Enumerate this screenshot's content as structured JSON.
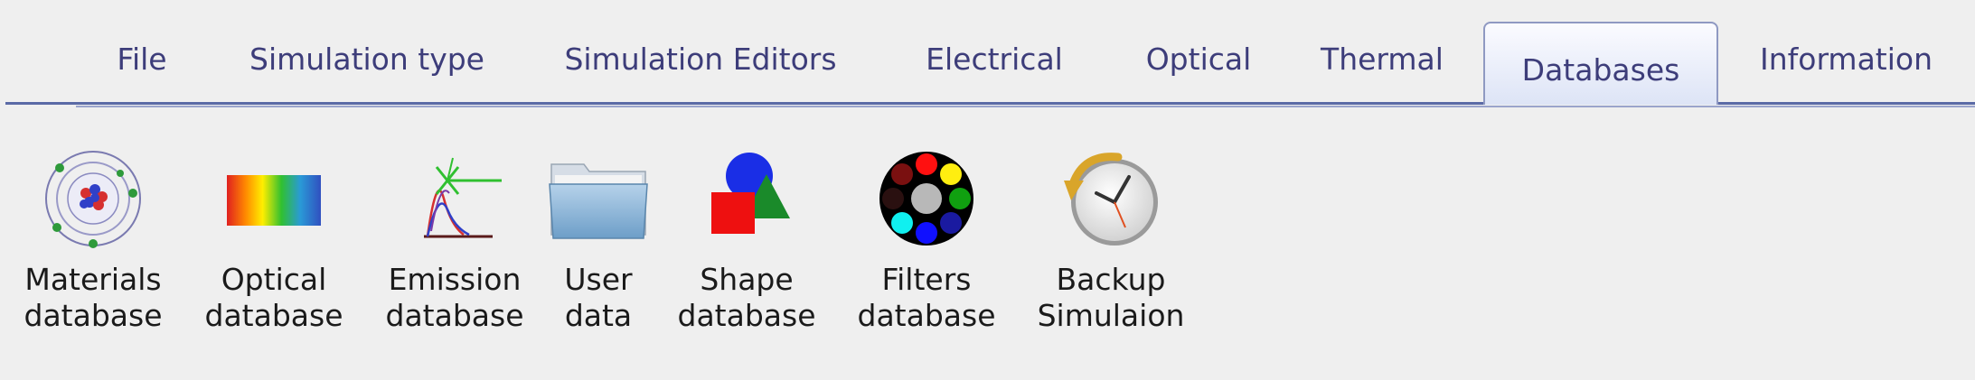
{
  "tabs": [
    {
      "label": "File",
      "active": false
    },
    {
      "label": "Simulation type",
      "active": false
    },
    {
      "label": "Simulation Editors",
      "active": false
    },
    {
      "label": "Electrical",
      "active": false
    },
    {
      "label": "Optical",
      "active": false
    },
    {
      "label": "Thermal",
      "active": false
    },
    {
      "label": "Databases",
      "active": true
    },
    {
      "label": "Information",
      "active": false
    }
  ],
  "toolbar": {
    "items": [
      {
        "line1": "Materials",
        "line2": "database",
        "icon": "atom-icon"
      },
      {
        "line1": "Optical",
        "line2": "database",
        "icon": "spectrum-icon"
      },
      {
        "line1": "Emission",
        "line2": "database",
        "icon": "emission-spectrum-icon"
      },
      {
        "line1": "User",
        "line2": "data",
        "icon": "folder-icon"
      },
      {
        "line1": "Shape",
        "line2": "database",
        "icon": "shapes-icon"
      },
      {
        "line1": "Filters",
        "line2": "database",
        "icon": "filter-wheel-icon"
      },
      {
        "line1": "Backup",
        "line2": "Simulaion",
        "icon": "clock-backup-icon"
      }
    ]
  },
  "colors": {
    "background": "#efefef",
    "tab_text": "#3d3d7a",
    "tab_active_border": "#8f99c2",
    "tab_underline": "#5a6aa6"
  }
}
